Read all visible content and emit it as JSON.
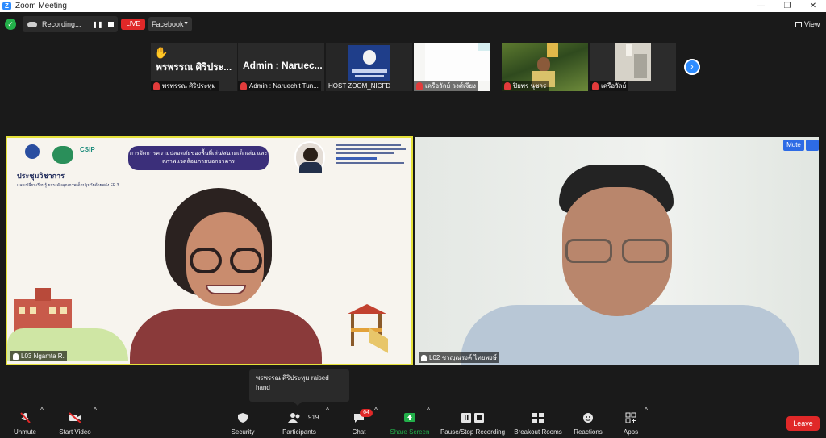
{
  "window": {
    "title": "Zoom Meeting",
    "logo": "Z"
  },
  "topbar": {
    "recording_label": "Recording...",
    "live_label": "LIVE",
    "stream_target": "Facebook",
    "view_label": "View"
  },
  "thumbnails": [
    {
      "name": "พรพรรณ ศิริประหุม",
      "big": "พรพรรณ ศิริประ...",
      "raised_hand": true
    },
    {
      "name": "Admin : Naruechit Tun...",
      "big": "Admin : Naruec..."
    },
    {
      "name": "HOST ZOOM_NICFD"
    },
    {
      "name": "เครือวัลย์ วงศ์เจียง"
    },
    {
      "name": "ปิยพร นุชาร"
    },
    {
      "name": "เครือวัลย์"
    }
  ],
  "main": {
    "left_label": "L03 Ngamta R.",
    "right_label": "L02 ชาญณรงค์ ไทยพงษ์",
    "mute_label": "Mute",
    "more_label": "···",
    "poster": {
      "banner": "การจัดการความปลอดภัยของพื้นที่เล่น/สนามเด็กเล่น และสภาพแวดล้อมภายนอกอาคาร",
      "heading": "ประชุมวิชาการ",
      "subheading": "แลกเปลี่ยนเรียนรู้ ยกระดับคุณภาพเด็กปฐมวัยด้วยพลัง EP 3",
      "logo_text": "CSIP"
    }
  },
  "tooltip": "พรพรรณ ศิริประหุม raised hand",
  "toolbar": {
    "unmute": "Unmute",
    "start_video": "Start Video",
    "security": "Security",
    "participants": "Participants",
    "participants_count": "919",
    "chat": "Chat",
    "chat_badge": "64",
    "share_screen": "Share Screen",
    "recording": "Pause/Stop Recording",
    "breakout": "Breakout Rooms",
    "reactions": "Reactions",
    "apps": "Apps",
    "leave": "Leave"
  },
  "colors": {
    "accent": "#2d8cff",
    "live": "#e02828",
    "share": "#23b04a",
    "active_speaker": "#e6e23a"
  }
}
